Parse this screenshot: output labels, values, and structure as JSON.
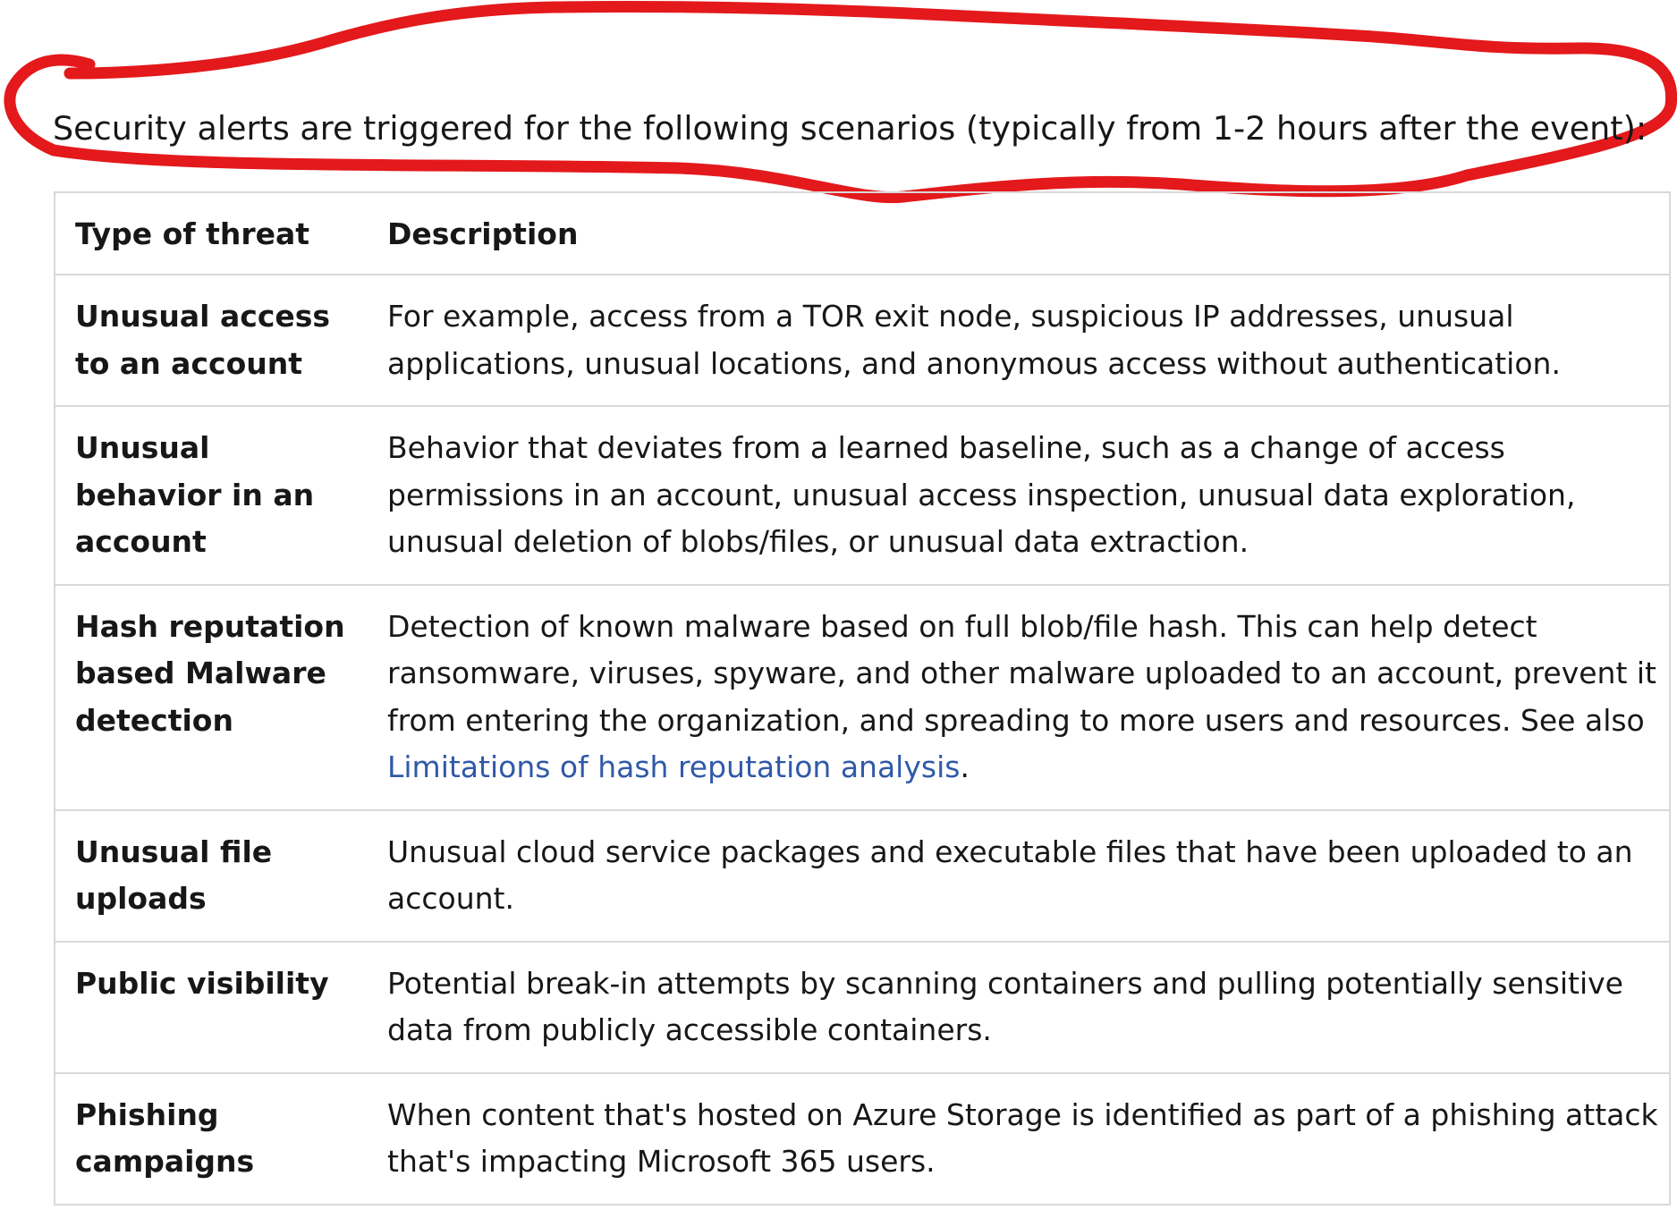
{
  "intro_text": "Security alerts are triggered for the following scenarios (typically from 1-2 hours after the event):",
  "table": {
    "headers": {
      "type": "Type of threat",
      "description": "Description"
    },
    "rows": [
      {
        "type": "Unusual access to an account",
        "description": "For example, access from a TOR exit node, suspicious IP addresses, unusual applications, unusual locations, and anonymous access without authentication."
      },
      {
        "type": "Unusual behavior in an account",
        "description": "Behavior that deviates from a learned baseline, such as a change of access permissions in an account, unusual access inspection, unusual data exploration, unusual deletion of blobs/files, or unusual data extraction."
      },
      {
        "type": "Hash reputation based Malware detection",
        "description_prefix": "Detection of known malware based on full blob/file hash. This can help detect ransomware, viruses, spyware, and other malware uploaded to an account, prevent it from entering the organization, and spreading to more users and resources. See also ",
        "link_text": "Limitations of hash reputation analysis",
        "description_suffix": "."
      },
      {
        "type": "Unusual file uploads",
        "description": "Unusual cloud service packages and executable files that have been uploaded to an account."
      },
      {
        "type": "Public visibility",
        "description": "Potential break-in attempts by scanning containers and pulling potentially sensitive data from publicly accessible containers."
      },
      {
        "type": "Phishing campaigns",
        "description": "When content that's hosted on Azure Storage is identified as part of a phishing attack that's impacting Microsoft 365 users."
      }
    ]
  },
  "colors": {
    "annotation_red": "#e3191c",
    "link_blue": "#3059a8",
    "border_gray": "#d8d8d8",
    "text": "#171717"
  }
}
